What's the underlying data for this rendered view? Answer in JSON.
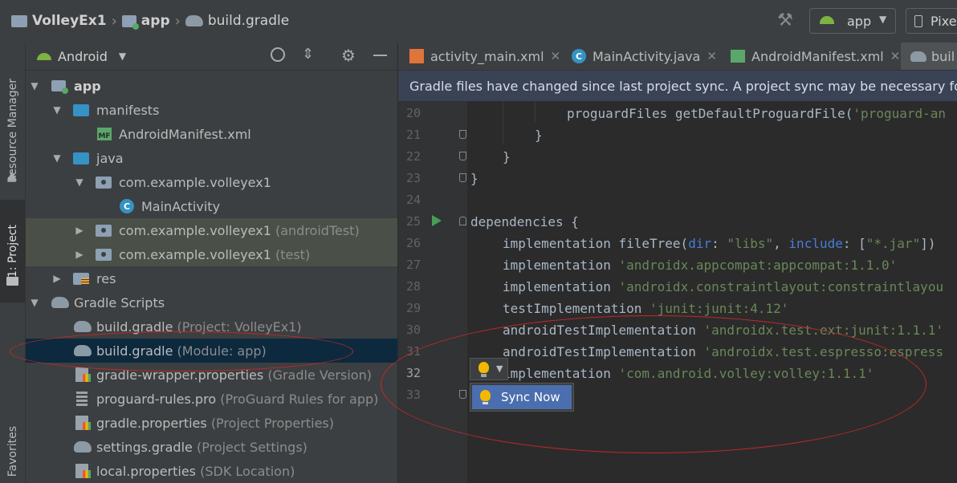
{
  "breadcrumb": {
    "project": "VolleyEx1",
    "module": "app",
    "file": "build.gradle"
  },
  "toolbar": {
    "run_config": "app",
    "device": "Pixe"
  },
  "left_strip": {
    "resource_manager": "Resource Manager",
    "project_tab": "1: Project",
    "favorites": "Favorites"
  },
  "project_panel": {
    "view_mode": "Android"
  },
  "tree": {
    "app": "app",
    "manifests": "manifests",
    "android_manifest": "AndroidManifest.xml",
    "java": "java",
    "pkg_main": "com.example.volleyex1",
    "main_activity": "MainActivity",
    "pkg_android_test": "com.example.volleyex1",
    "pkg_android_test_hint": "(androidTest)",
    "pkg_test": "com.example.volleyex1",
    "pkg_test_hint": "(test)",
    "res": "res",
    "gradle_scripts": "Gradle Scripts",
    "build_project": "build.gradle",
    "build_project_hint": "(Project: VolleyEx1)",
    "build_module": "build.gradle",
    "build_module_hint": "(Module: app)",
    "wrapper": "gradle-wrapper.properties",
    "wrapper_hint": "(Gradle Version)",
    "proguard": "proguard-rules.pro",
    "proguard_hint": "(ProGuard Rules for app)",
    "gradle_props": "gradle.properties",
    "gradle_props_hint": "(Project Properties)",
    "settings": "settings.gradle",
    "settings_hint": "(Project Settings)",
    "local": "local.properties",
    "local_hint": "(SDK Location)"
  },
  "tabs": [
    "activity_main.xml",
    "MainActivity.java",
    "AndroidManifest.xml",
    "buil"
  ],
  "banner": "Gradle files have changed since last project sync. A project sync may be necessary for the IDE",
  "line_numbers": [
    "20",
    "21",
    "22",
    "23",
    "24",
    "25",
    "26",
    "27",
    "28",
    "29",
    "30",
    "31",
    "32",
    "33"
  ],
  "code": {
    "l20_a": "proguardFiles getDefaultProguardFile(",
    "l20_b": "'proguard-an",
    "l21": "}",
    "l22": "}",
    "l23": "}",
    "l25": "dependencies {",
    "l26_a": "implementation fileTree(",
    "l26_b": "dir",
    "l26_c": ": ",
    "l26_d": "\"libs\"",
    "l26_e": ", ",
    "l26_f": "include",
    "l26_g": ": [",
    "l26_h": "\"*.jar\"",
    "l26_i": "])",
    "l27_a": "implementation ",
    "l27_b": "'androidx.appcompat:appcompat:1.1.0'",
    "l28_a": "implementation ",
    "l28_b": "'androidx.constraintlayout:constraintlayou",
    "l29_a": "testImplementation ",
    "l29_b": "'junit:junit:4.12'",
    "l30_a": "androidTestImplementation ",
    "l30_b": "'androidx.test.ext:junit:1.1.1'",
    "l31_a": "androidTestImplementation ",
    "l31_b": "'androidx.test.espresso:espress",
    "l32_a": "implementation ",
    "l32_b": "'com.android.volley:volley:1.1.1'"
  },
  "intention": {
    "sync_now": "Sync Now"
  },
  "colors": {
    "annotation_red": "#c42828",
    "banner_bg": "#3a4255",
    "selection_bg": "#0d293e",
    "sync_blue": "#4b6eaf",
    "bulb_yellow": "#f5b800"
  }
}
